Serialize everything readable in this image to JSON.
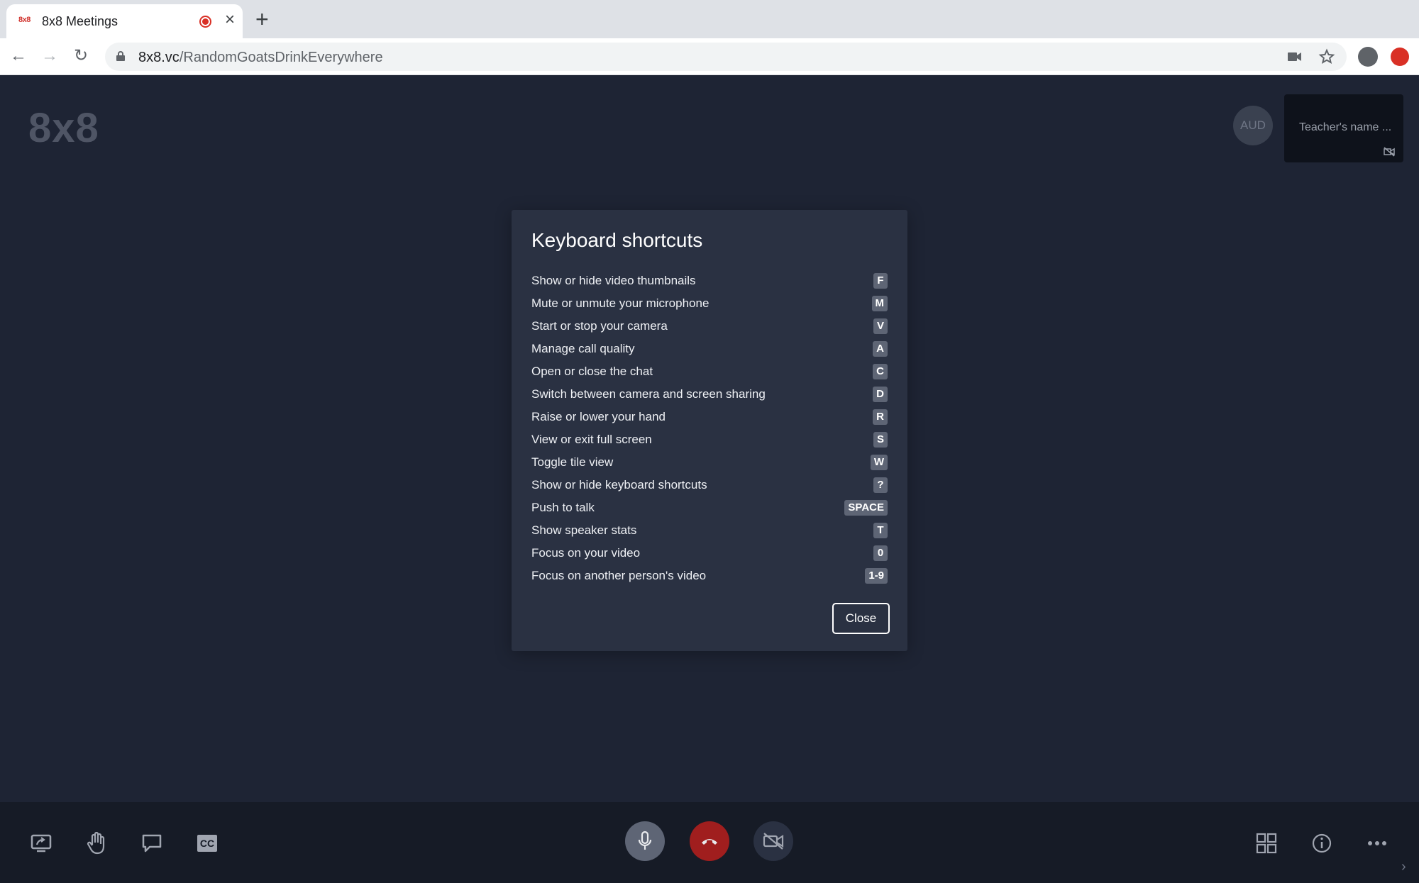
{
  "browser": {
    "tab_title": "8x8 Meetings",
    "favicon_text": "8x8",
    "url_host": "8x8.vc",
    "url_path": "/RandomGoatsDrinkEverywhere"
  },
  "stage": {
    "watermark": "8x8",
    "avatar_initials": "AUD",
    "thumbnail_name": "Teacher's name ..."
  },
  "dialog": {
    "title": "Keyboard shortcuts",
    "shortcuts": [
      {
        "label": "Show or hide video thumbnails",
        "key": "F"
      },
      {
        "label": "Mute or unmute your microphone",
        "key": "M"
      },
      {
        "label": "Start or stop your camera",
        "key": "V"
      },
      {
        "label": "Manage call quality",
        "key": "A"
      },
      {
        "label": "Open or close the chat",
        "key": "C"
      },
      {
        "label": "Switch between camera and screen sharing",
        "key": "D"
      },
      {
        "label": "Raise or lower your hand",
        "key": "R"
      },
      {
        "label": "View or exit full screen",
        "key": "S"
      },
      {
        "label": "Toggle tile view",
        "key": "W"
      },
      {
        "label": "Show or hide keyboard shortcuts",
        "key": "?"
      },
      {
        "label": "Push to talk",
        "key": "SPACE"
      },
      {
        "label": "Show speaker stats",
        "key": "T"
      },
      {
        "label": "Focus on your video",
        "key": "0"
      },
      {
        "label": "Focus on another person's video",
        "key": "1-9"
      }
    ],
    "close_label": "Close"
  },
  "toolbar": {
    "cc_label": "CC"
  },
  "colors": {
    "background": "#1e2434",
    "dialog": "#2a3142",
    "hangup": "#a01e1e",
    "key_badge": "#5e6575"
  }
}
